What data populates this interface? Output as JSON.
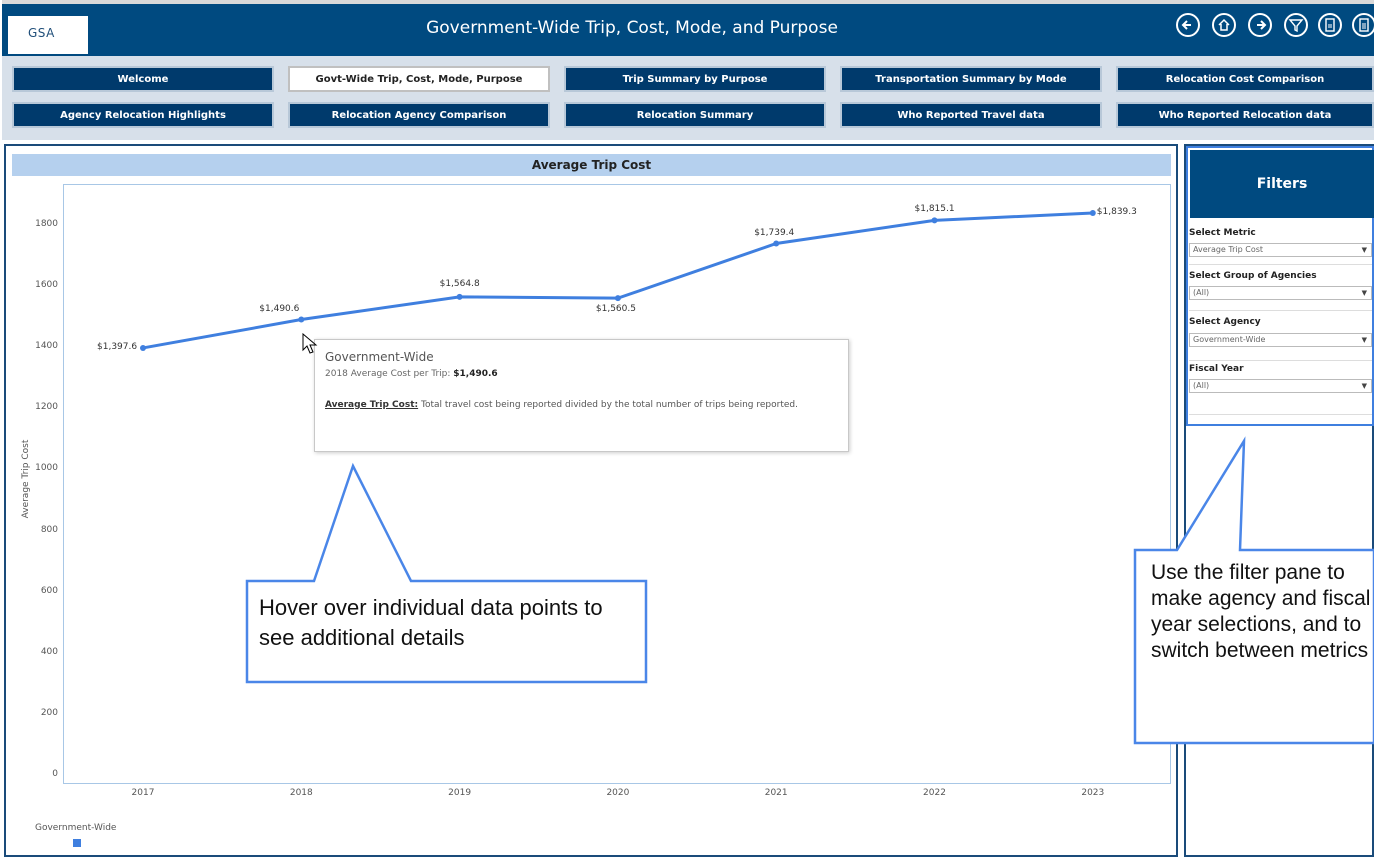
{
  "header": {
    "logo_text": "GSA",
    "title": "Government-Wide Trip, Cost, Mode, and Purpose",
    "icons": [
      "back-arrow-icon",
      "home-icon",
      "forward-arrow-icon",
      "filter-icon",
      "pdf-icon",
      "csv-icon"
    ]
  },
  "nav": {
    "row1": [
      "Welcome",
      "Govt-Wide Trip, Cost, Mode, Purpose",
      "Trip Summary by Purpose",
      "Transportation Summary by Mode",
      "Relocation Cost Comparison"
    ],
    "row2": [
      "Agency Relocation Highlights",
      "Relocation Agency Comparison",
      "Relocation Summary",
      "Who Reported Travel data",
      "Who Reported Relocation data"
    ],
    "active": "Govt-Wide Trip, Cost, Mode, Purpose"
  },
  "chart_data": {
    "type": "line",
    "title": "Average Trip Cost",
    "xlabel": "",
    "ylabel": "Average Trip Cost",
    "x": [
      "2017",
      "2018",
      "2019",
      "2020",
      "2021",
      "2022",
      "2023"
    ],
    "series": [
      {
        "name": "Government-Wide",
        "values": [
          1397.6,
          1490.6,
          1564.8,
          1560.5,
          1739.4,
          1815.1,
          1839.3
        ],
        "labels": [
          "$1,397.6",
          "$1,490.6",
          "$1,564.8",
          "$1,560.5",
          "$1,739.4",
          "$1,815.1",
          "$1,839.3"
        ],
        "color": "#3f7fdf"
      }
    ],
    "yticks": [
      "0",
      "200",
      "400",
      "600",
      "800",
      "1000",
      "1200",
      "1400",
      "1600",
      "1800"
    ],
    "ylim": [
      0,
      1900
    ],
    "grid": false,
    "legend_position": "bottom-left"
  },
  "legend": {
    "title": "Government-Wide"
  },
  "tooltip": {
    "title": "Government-Wide",
    "line_prefix": "2018 Average Cost per Trip:",
    "line_value": "$1,490.6",
    "def_term": "Average Trip Cost:",
    "def_text": "Total travel cost being reported divided by the total number of trips being reported."
  },
  "filters": {
    "heading": "Filters",
    "items": [
      {
        "label": "Select Metric",
        "value": "Average Trip Cost"
      },
      {
        "label": "Select Group of Agencies",
        "value": "(All)"
      },
      {
        "label": "Select Agency",
        "value": "Government-Wide"
      },
      {
        "label": "Fiscal Year",
        "value": "(All)"
      }
    ]
  },
  "callouts": {
    "hover": "Hover over individual data points to see additional details",
    "filter": "Use the filter pane to make agency and fiscal year selections, and to switch between metrics"
  }
}
